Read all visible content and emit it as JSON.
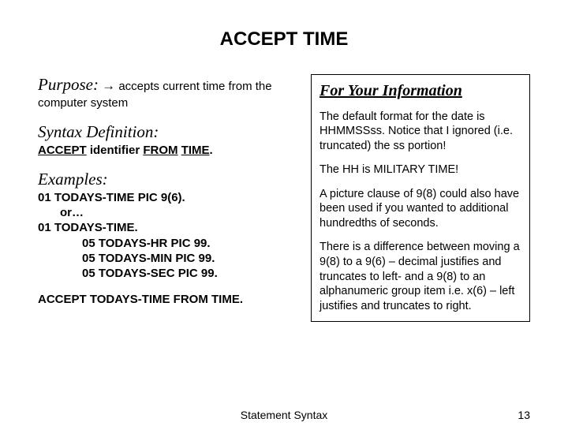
{
  "title": "ACCEPT TIME",
  "left": {
    "purpose_label": "Purpose:",
    "purpose_arrow": "→",
    "purpose_text": " accepts current time from the computer system",
    "syntax_label": "Syntax Definition:",
    "syntax_accept": "ACCEPT",
    "syntax_identifier": " identifier ",
    "syntax_from": "FROM",
    "syntax_space": " ",
    "syntax_time": "TIME",
    "syntax_period": ".",
    "examples_label": "Examples:",
    "ex_line1": "01 TODAYS-TIME PIC 9(6).",
    "ex_or": "or…",
    "ex_line2": "01 TODAYS-TIME.",
    "ex_line3": "05  TODAYS-HR PIC  99.",
    "ex_line4": "05  TODAYS-MIN PIC 99.",
    "ex_line5": "05  TODAYS-SEC  PIC 99.",
    "ex_accept": "ACCEPT TODAYS-TIME FROM TIME."
  },
  "fyi": {
    "heading": "For Your Information",
    "p1": "The default format for the date is HHMMSSss.  Notice that I ignored (i.e. truncated) the ss portion!",
    "p2": "The HH is MILITARY TIME!",
    "p3": "A picture clause of 9(8) could also have been used if you wanted to additional hundredths of seconds.",
    "p4": "There is a difference between moving a 9(8) to a 9(6) – decimal justifies and truncates to left-  and a 9(8) to an alphanumeric group item i.e. x(6) – left justifies and truncates to right."
  },
  "footer": {
    "center": "Statement Syntax",
    "page": "13"
  }
}
